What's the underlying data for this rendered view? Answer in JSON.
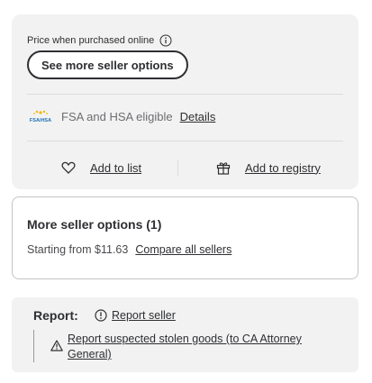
{
  "purchase": {
    "price_note": "Price when purchased online",
    "seller_options_button": "See more seller options"
  },
  "fsa": {
    "logo_text": "FSA/HSA",
    "label": "FSA and HSA eligible",
    "details_link": "Details"
  },
  "actions": {
    "add_to_list": "Add to list",
    "add_to_registry": "Add to registry"
  },
  "more_sellers": {
    "title": "More seller options (1)",
    "starting_from": "Starting from $11.63",
    "compare_link": "Compare all sellers"
  },
  "report": {
    "title": "Report:",
    "report_seller": "Report seller",
    "report_stolen": "Report suspected stolen goods (to CA Attorney General)"
  },
  "colors": {
    "fsa_logo_yellow": "#f5b400",
    "fsa_logo_blue": "#1f6fb5",
    "text_primary": "#2e2f32",
    "card_bg": "#f2f2f2"
  }
}
